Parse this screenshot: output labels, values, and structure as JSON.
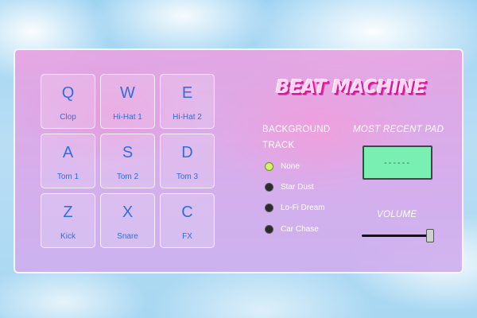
{
  "app": {
    "title": "BEAT MACHINE"
  },
  "pads": [
    {
      "key": "Q",
      "sound": "Clop"
    },
    {
      "key": "W",
      "sound": "Hi-Hat 1"
    },
    {
      "key": "E",
      "sound": "Hi-Hat 2"
    },
    {
      "key": "A",
      "sound": "Tom 1"
    },
    {
      "key": "S",
      "sound": "Tom 2"
    },
    {
      "key": "D",
      "sound": "Tom 3"
    },
    {
      "key": "Z",
      "sound": "Kick"
    },
    {
      "key": "X",
      "sound": "Snare"
    },
    {
      "key": "C",
      "sound": "FX"
    }
  ],
  "background_track": {
    "label_line1": "BACKGROUND",
    "label_line2": "TRACK",
    "options": [
      "None",
      "Star Dust",
      "Lo-Fi Dream",
      "Car Chase"
    ],
    "selected_index": 0
  },
  "recent_pad": {
    "label": "MOST RECENT PAD",
    "display_value": "------"
  },
  "volume": {
    "label": "VOLUME",
    "level_fraction": 0.95
  },
  "colors": {
    "pad_text": "#2e6ee0",
    "title_shadow": "#e0149a",
    "display_bg": "#79f0b1",
    "radio_selected": "#d6f06a"
  }
}
